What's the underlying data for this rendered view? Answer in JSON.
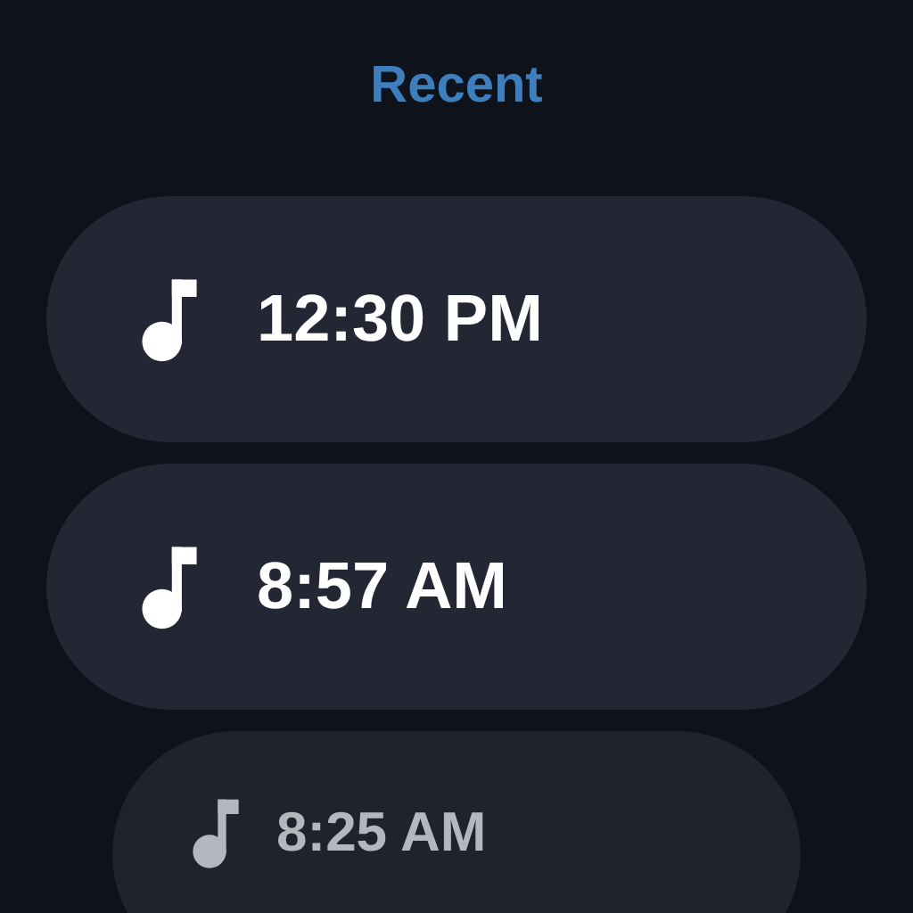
{
  "title": "Recent",
  "items": [
    {
      "time": "12:30 PM",
      "dimmed": false
    },
    {
      "time": "8:57 AM",
      "dimmed": false
    },
    {
      "time": "8:25 AM",
      "dimmed": true
    }
  ]
}
